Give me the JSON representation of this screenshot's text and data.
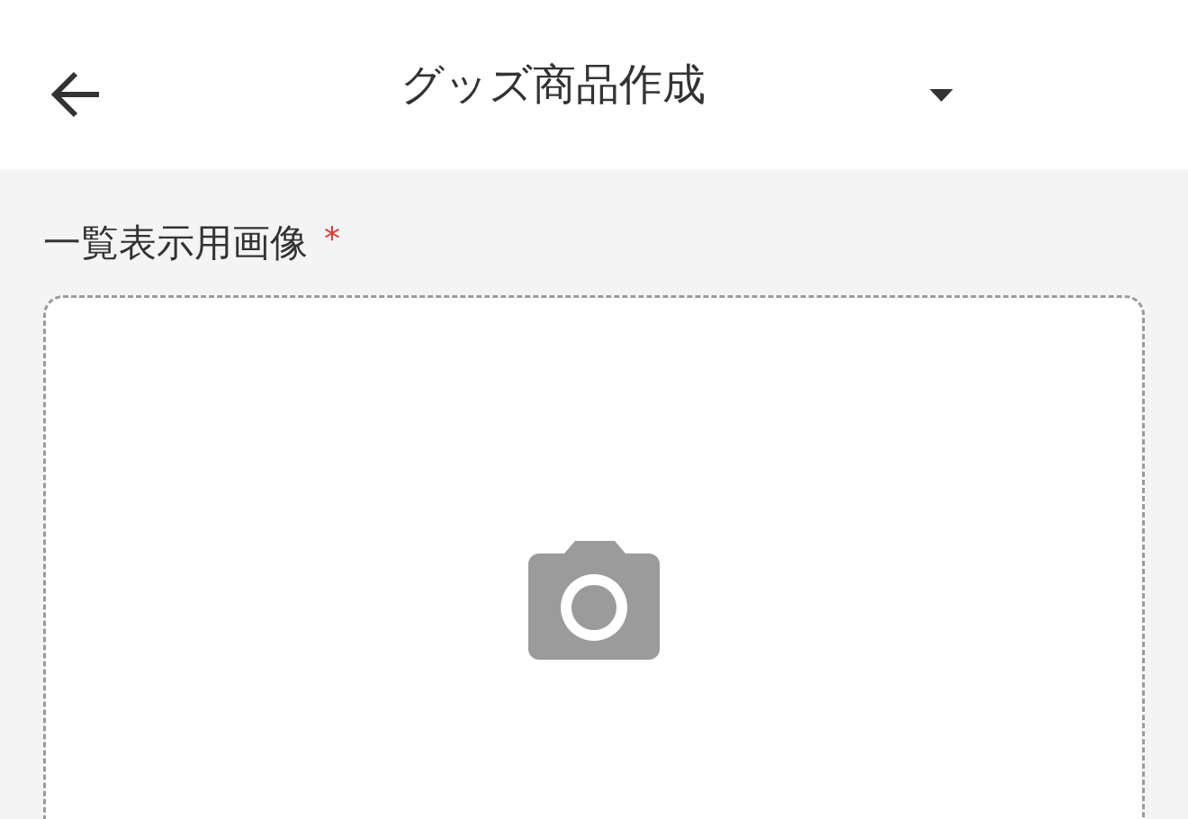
{
  "header": {
    "title": "グッズ商品作成"
  },
  "image_field": {
    "label": "一覧表示用画像",
    "required_mark": "*"
  }
}
